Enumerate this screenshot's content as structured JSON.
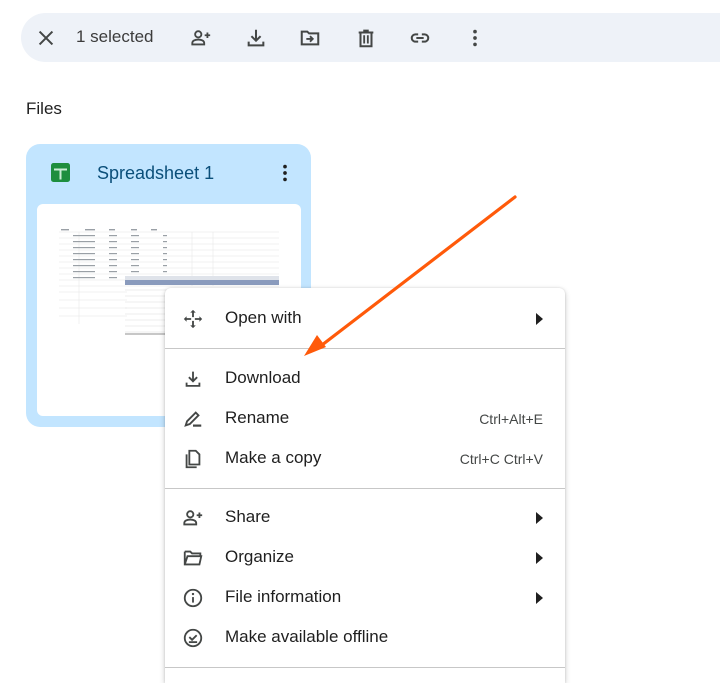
{
  "toolbar": {
    "selection_count": "1 selected",
    "buttons": [
      {
        "name": "clear-selection",
        "icon": "close-icon"
      },
      {
        "name": "share",
        "icon": "person-add-icon"
      },
      {
        "name": "download",
        "icon": "download-icon"
      },
      {
        "name": "move",
        "icon": "folder-move-icon"
      },
      {
        "name": "trash",
        "icon": "trash-icon"
      },
      {
        "name": "copy-link",
        "icon": "link-icon"
      },
      {
        "name": "more-actions",
        "icon": "more-vert-icon"
      }
    ]
  },
  "section": {
    "title": "Files"
  },
  "file_card": {
    "title": "Spreadsheet 1",
    "type_icon": "google-sheets-icon",
    "accent": "#1e8e3e",
    "selected_bg": "#c2e5ff"
  },
  "context_menu": {
    "groups": [
      [
        {
          "label": "Open with",
          "icon": "open-with-icon",
          "submenu": true
        }
      ],
      [
        {
          "label": "Download",
          "icon": "download-icon"
        },
        {
          "label": "Rename",
          "icon": "rename-icon",
          "shortcut": "Ctrl+Alt+E"
        },
        {
          "label": "Make a copy",
          "icon": "copy-icon",
          "shortcut": "Ctrl+C Ctrl+V"
        }
      ],
      [
        {
          "label": "Share",
          "icon": "person-add-icon",
          "submenu": true
        },
        {
          "label": "Organize",
          "icon": "folder-open-icon",
          "submenu": true
        },
        {
          "label": "File information",
          "icon": "info-icon",
          "submenu": true
        },
        {
          "label": "Make available offline",
          "icon": "offline-check-icon"
        }
      ]
    ]
  },
  "annotation": {
    "type": "arrow",
    "color": "#ff5a0a",
    "points_to": "Download"
  }
}
